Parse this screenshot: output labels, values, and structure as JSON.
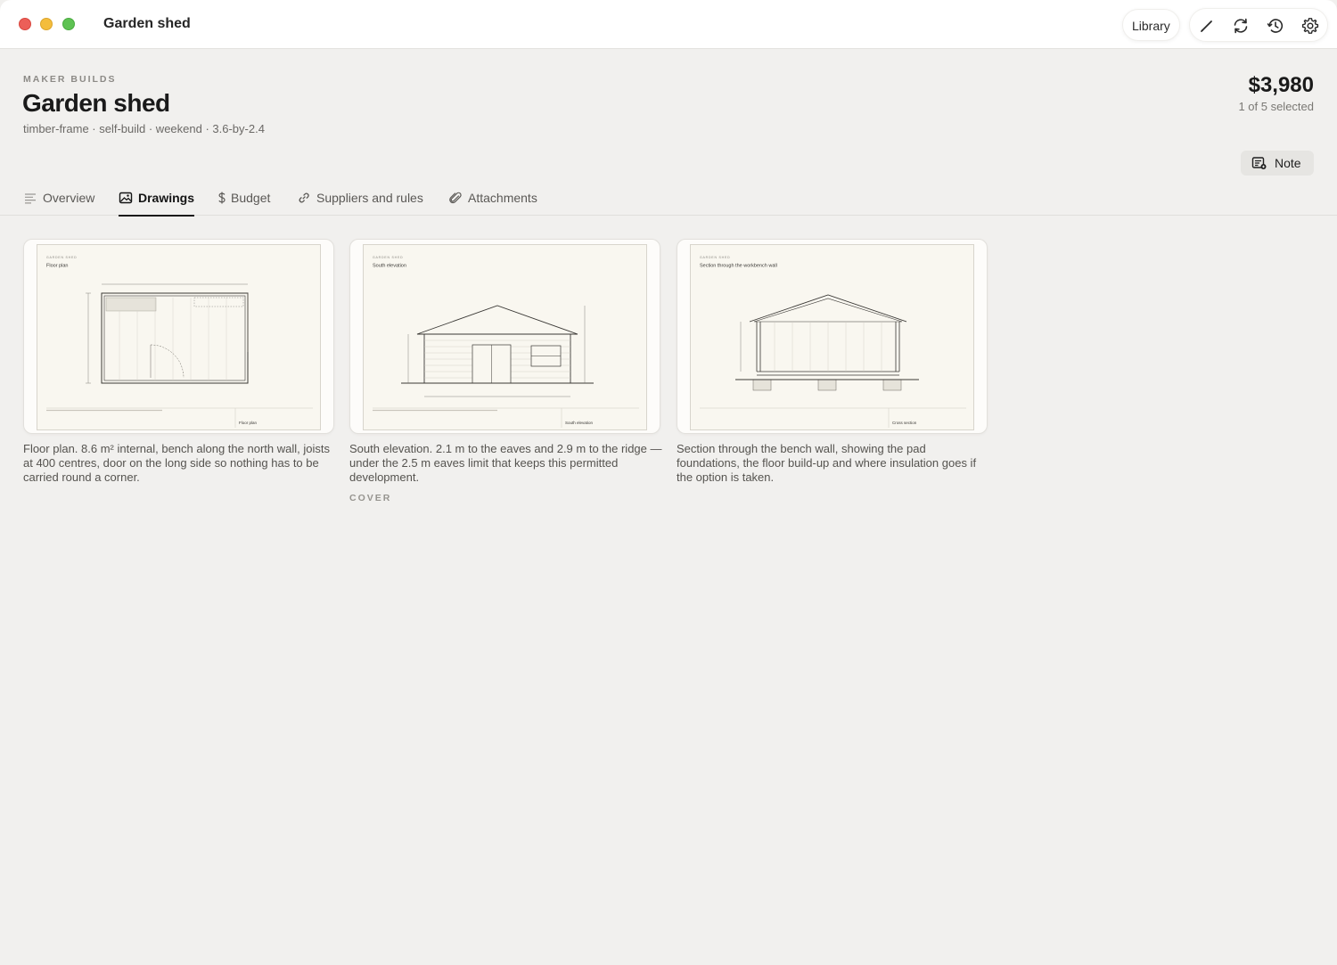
{
  "window": {
    "title": "Garden shed"
  },
  "toolbar": {
    "library_label": "Library",
    "icons": [
      "pencil-icon",
      "sync-icon",
      "history-icon",
      "gear-icon"
    ]
  },
  "header": {
    "eyebrow": "MAKER BUILDS",
    "title": "Garden shed",
    "tags": "timber-frame · self-build · weekend · 3.6-by-2.4",
    "price": "$3,980",
    "selected": "1 of 5 selected",
    "note_label": "Note"
  },
  "tabs": [
    {
      "label": "Overview",
      "icon": "lines-icon",
      "active": false
    },
    {
      "label": "Drawings",
      "icon": "image-icon",
      "active": true
    },
    {
      "label": "Budget",
      "icon": "dollar-icon",
      "active": false
    },
    {
      "label": "Suppliers and rules",
      "icon": "link-icon",
      "active": false
    },
    {
      "label": "Attachments",
      "icon": "paperclip-icon",
      "active": false
    }
  ],
  "drawings": [
    {
      "sheet_project": "GARDEN SHED",
      "sheet_title": "Floor plan",
      "titleblock": "Floor plan",
      "caption": "Floor plan. 8.6 m² internal, bench along the north wall, joists at 400 centres, door on the long side so nothing has to be carried round a corner."
    },
    {
      "sheet_project": "GARDEN SHED",
      "sheet_title": "South elevation",
      "titleblock": "South elevation",
      "caption": "South elevation. 2.1 m to the eaves and 2.9 m to the ridge — under the 2.5 m eaves limit that keeps this permitted development.",
      "badge": "COVER"
    },
    {
      "sheet_project": "GARDEN SHED",
      "sheet_title": "Section through the workbench wall",
      "titleblock": "Cross section",
      "caption": "Section through the bench wall, showing the pad foundations, the floor build-up and where insulation goes if the option is taken."
    }
  ]
}
